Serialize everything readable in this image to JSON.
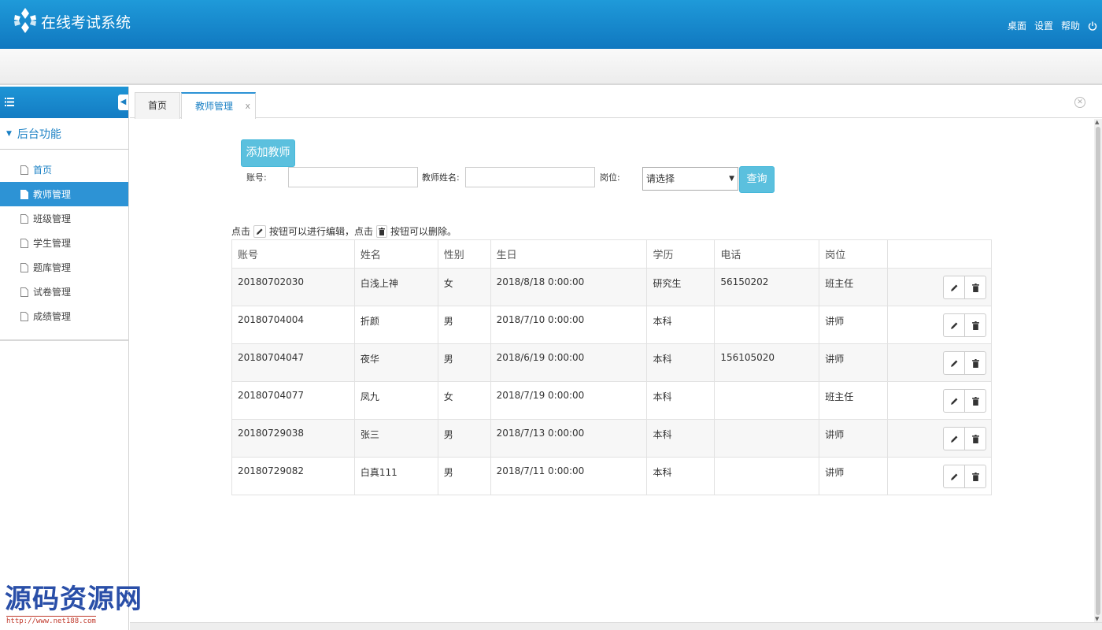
{
  "app": {
    "title": "在线考试系统"
  },
  "top_links": {
    "desktop": "桌面",
    "settings": "设置",
    "help": "帮助"
  },
  "sidebar": {
    "section": "后台功能",
    "items": [
      {
        "label": "首页"
      },
      {
        "label": "教师管理"
      },
      {
        "label": "班级管理"
      },
      {
        "label": "学生管理"
      },
      {
        "label": "题库管理"
      },
      {
        "label": "试卷管理"
      },
      {
        "label": "成绩管理"
      }
    ]
  },
  "tabs": {
    "home": "首页",
    "teacher": "教师管理",
    "close": "x"
  },
  "toolbar": {
    "add_label": "添加教师",
    "account_label": "账号:",
    "name_label": "教师姓名:",
    "position_label": "岗位:",
    "position_selected": "请选择",
    "query_label": "查询"
  },
  "hint": {
    "part1": "点击",
    "part2": "按钮可以进行编辑，点击",
    "part3": "按钮可以删除。"
  },
  "table": {
    "headers": [
      "账号",
      "姓名",
      "性别",
      "生日",
      "学历",
      "电话",
      "岗位",
      ""
    ],
    "rows": [
      [
        "20180702030",
        "白浅上神",
        "女",
        "2018/8/18 0:00:00",
        "研究生",
        "56150202",
        "班主任"
      ],
      [
        "20180704004",
        "折颜",
        "男",
        "2018/7/10 0:00:00",
        "本科",
        "",
        "讲师"
      ],
      [
        "20180704047",
        "夜华",
        "男",
        "2018/6/19 0:00:00",
        "本科",
        "156105020",
        "讲师"
      ],
      [
        "20180704077",
        "凤九",
        "女",
        "2018/7/19 0:00:00",
        "本科",
        "",
        "班主任"
      ],
      [
        "20180729038",
        "张三",
        "男",
        "2018/7/13 0:00:00",
        "本科",
        "",
        "讲师"
      ],
      [
        "20180729082",
        "白真111",
        "男",
        "2018/7/11 0:00:00",
        "本科",
        "",
        "讲师"
      ]
    ]
  },
  "watermark": {
    "text": "源码资源网",
    "url": "http://www.net188.com"
  },
  "colors": {
    "header": "#1078c0",
    "accent": "#2d93d5",
    "button": "#5bc0de"
  }
}
